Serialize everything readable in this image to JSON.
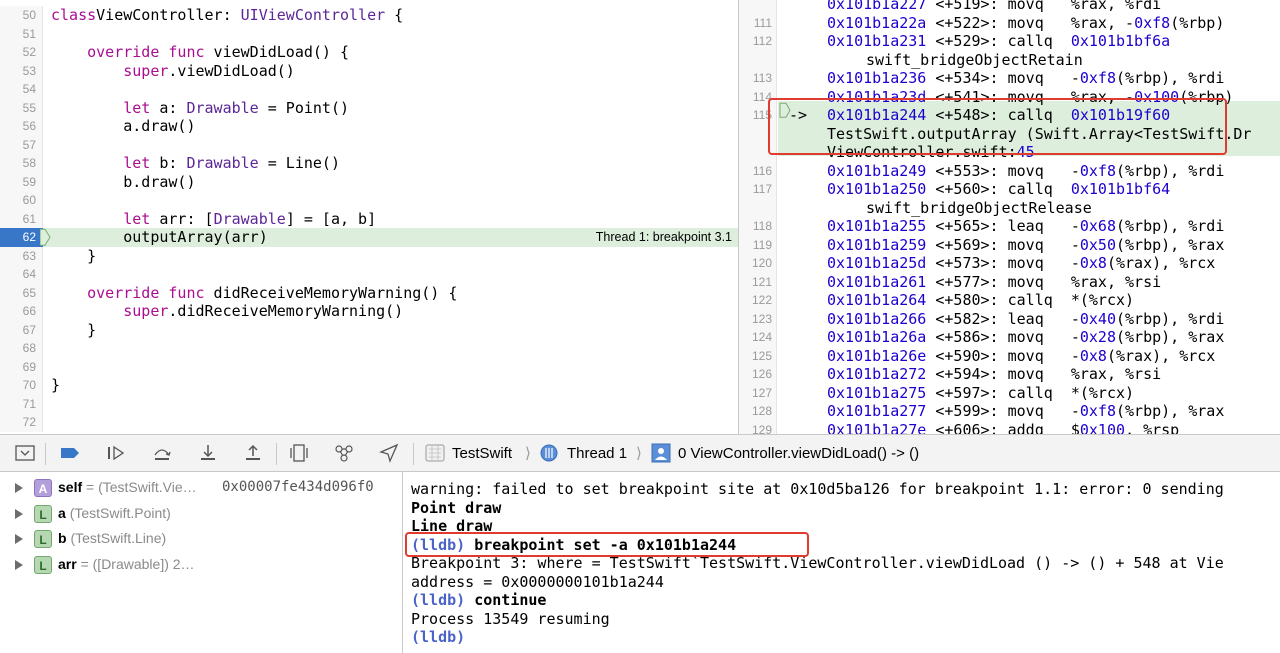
{
  "editor": {
    "lines": [
      {
        "num": "50",
        "parts": [
          [
            "kw",
            "class"
          ],
          [
            "",
            "ViewController: "
          ],
          [
            "ty",
            "UIViewController"
          ],
          [
            "",
            " {"
          ]
        ]
      },
      {
        "num": "51",
        "parts": []
      },
      {
        "num": "52",
        "parts": [
          [
            "",
            "    "
          ],
          [
            "kw",
            "override"
          ],
          [
            "",
            ""
          ],
          [
            "kw",
            " func"
          ],
          [
            "",
            " viewDidLoad() {"
          ]
        ]
      },
      {
        "num": "53",
        "parts": [
          [
            "",
            "        "
          ],
          [
            "kw",
            "super"
          ],
          [
            "",
            ".viewDidLoad()"
          ]
        ]
      },
      {
        "num": "54",
        "parts": []
      },
      {
        "num": "55",
        "parts": [
          [
            "",
            "        "
          ],
          [
            "kw",
            "let"
          ],
          [
            "",
            " a: "
          ],
          [
            "ty",
            "Drawable"
          ],
          [
            "",
            " = Point()"
          ]
        ]
      },
      {
        "num": "56",
        "parts": [
          [
            "",
            "        a.draw()"
          ]
        ]
      },
      {
        "num": "57",
        "parts": []
      },
      {
        "num": "58",
        "parts": [
          [
            "",
            "        "
          ],
          [
            "kw",
            "let"
          ],
          [
            "",
            " b: "
          ],
          [
            "ty",
            "Drawable"
          ],
          [
            "",
            " = Line()"
          ]
        ]
      },
      {
        "num": "59",
        "parts": [
          [
            "",
            "        b.draw()"
          ]
        ]
      },
      {
        "num": "60",
        "parts": []
      },
      {
        "num": "61",
        "parts": [
          [
            "",
            "        "
          ],
          [
            "kw",
            "let"
          ],
          [
            "",
            " arr: ["
          ],
          [
            "ty",
            "Drawable"
          ],
          [
            "",
            "] = [a, b]"
          ]
        ]
      },
      {
        "num": "62",
        "parts": [
          [
            "",
            "        outputArray(arr)"
          ]
        ],
        "highlight": true
      },
      {
        "num": "63",
        "parts": [
          [
            "",
            "    }"
          ]
        ]
      },
      {
        "num": "64",
        "parts": []
      },
      {
        "num": "65",
        "parts": [
          [
            "",
            "    "
          ],
          [
            "kw",
            "override"
          ],
          [
            "kw",
            " func"
          ],
          [
            "",
            " didReceiveMemoryWarning() {"
          ]
        ]
      },
      {
        "num": "66",
        "parts": [
          [
            "",
            "        "
          ],
          [
            "kw",
            "super"
          ],
          [
            "",
            ".didReceiveMemoryWarning()"
          ]
        ]
      },
      {
        "num": "67",
        "parts": [
          [
            "",
            "    }"
          ]
        ]
      },
      {
        "num": "68",
        "parts": []
      },
      {
        "num": "69",
        "parts": []
      },
      {
        "num": "70",
        "parts": [
          [
            "",
            "}"
          ]
        ]
      },
      {
        "num": "71",
        "parts": []
      },
      {
        "num": "72",
        "parts": []
      }
    ],
    "thread_label": "Thread 1: breakpoint 3.1"
  },
  "disasm": {
    "lines": [
      {
        "num": "",
        "parts": [
          [
            "addr",
            "0x101b1a227"
          ],
          [
            "",
            " <+519>: movq   %rax, %rdi"
          ]
        ]
      },
      {
        "num": "111",
        "parts": [
          [
            "addr",
            "0x101b1a22a"
          ],
          [
            "",
            " <+522>: movq   %rax, -"
          ],
          [
            "num",
            "0xf8"
          ],
          [
            "",
            "(%rbp)"
          ]
        ]
      },
      {
        "num": "112",
        "parts": [
          [
            "addr",
            "0x101b1a231"
          ],
          [
            "",
            " <+529>: callq  "
          ],
          [
            "addr",
            "0x101b1bf6a"
          ]
        ]
      },
      {
        "num": "",
        "cont": "swift_bridgeObjectRetain"
      },
      {
        "num": "113",
        "parts": [
          [
            "addr",
            "0x101b1a236"
          ],
          [
            "",
            " <+534>: movq   -"
          ],
          [
            "num",
            "0xf8"
          ],
          [
            "",
            "(%rbp), %rdi"
          ]
        ]
      },
      {
        "num": "114",
        "parts": [
          [
            "addr",
            "0x101b1a23d"
          ],
          [
            "",
            " <+541>: movq   %rax, -"
          ],
          [
            "num",
            "0x100"
          ],
          [
            "",
            "(%rbp)"
          ]
        ]
      },
      {
        "num": "115",
        "parts": [
          [
            "addr",
            "0x101b1a244"
          ],
          [
            "",
            " <+548>: callq  "
          ],
          [
            "addr",
            "0x101b19f60"
          ]
        ],
        "pc": true
      },
      {
        "num": "",
        "parts": [
          [
            "",
            "TestSwift.outputArray (Swift.Array<TestSwift.Dr"
          ]
        ],
        "hl": true
      },
      {
        "num": "",
        "parts": [
          [
            "",
            "ViewController.swift:"
          ],
          [
            "addr",
            "45"
          ]
        ],
        "hl": true
      },
      {
        "num": "116",
        "parts": [
          [
            "addr",
            "0x101b1a249"
          ],
          [
            "",
            " <+553>: movq   -"
          ],
          [
            "num",
            "0xf8"
          ],
          [
            "",
            "(%rbp), %rdi"
          ]
        ]
      },
      {
        "num": "117",
        "parts": [
          [
            "addr",
            "0x101b1a250"
          ],
          [
            "",
            " <+560>: callq  "
          ],
          [
            "addr",
            "0x101b1bf64"
          ]
        ]
      },
      {
        "num": "",
        "cont": "swift_bridgeObjectRelease"
      },
      {
        "num": "118",
        "parts": [
          [
            "addr",
            "0x101b1a255"
          ],
          [
            "",
            " <+565>: leaq   -"
          ],
          [
            "num",
            "0x68"
          ],
          [
            "",
            "(%rbp), %rdi"
          ]
        ]
      },
      {
        "num": "119",
        "parts": [
          [
            "addr",
            "0x101b1a259"
          ],
          [
            "",
            " <+569>: movq   -"
          ],
          [
            "num",
            "0x50"
          ],
          [
            "",
            "(%rbp), %rax"
          ]
        ]
      },
      {
        "num": "120",
        "parts": [
          [
            "addr",
            "0x101b1a25d"
          ],
          [
            "",
            " <+573>: movq   -"
          ],
          [
            "num",
            "0x8"
          ],
          [
            "",
            "(%rax), %rcx"
          ]
        ]
      },
      {
        "num": "121",
        "parts": [
          [
            "addr",
            "0x101b1a261"
          ],
          [
            "",
            " <+577>: movq   %rax, %rsi"
          ]
        ]
      },
      {
        "num": "122",
        "parts": [
          [
            "addr",
            "0x101b1a264"
          ],
          [
            "",
            " <+580>: callq  *(%rcx)"
          ]
        ]
      },
      {
        "num": "123",
        "parts": [
          [
            "addr",
            "0x101b1a266"
          ],
          [
            "",
            " <+582>: leaq   -"
          ],
          [
            "num",
            "0x40"
          ],
          [
            "",
            "(%rbp), %rdi"
          ]
        ]
      },
      {
        "num": "124",
        "parts": [
          [
            "addr",
            "0x101b1a26a"
          ],
          [
            "",
            " <+586>: movq   -"
          ],
          [
            "num",
            "0x28"
          ],
          [
            "",
            "(%rbp), %rax"
          ]
        ]
      },
      {
        "num": "125",
        "parts": [
          [
            "addr",
            "0x101b1a26e"
          ],
          [
            "",
            " <+590>: movq   -"
          ],
          [
            "num",
            "0x8"
          ],
          [
            "",
            "(%rax), %rcx"
          ]
        ]
      },
      {
        "num": "126",
        "parts": [
          [
            "addr",
            "0x101b1a272"
          ],
          [
            "",
            " <+594>: movq   %rax, %rsi"
          ]
        ]
      },
      {
        "num": "127",
        "parts": [
          [
            "addr",
            "0x101b1a275"
          ],
          [
            "",
            " <+597>: callq  *(%rcx)"
          ]
        ]
      },
      {
        "num": "128",
        "parts": [
          [
            "addr",
            "0x101b1a277"
          ],
          [
            "",
            " <+599>: movq   -"
          ],
          [
            "num",
            "0xf8"
          ],
          [
            "",
            "(%rbp), %rax"
          ]
        ]
      },
      {
        "num": "129",
        "parts": [
          [
            "addr",
            "0x101b1a27e"
          ],
          [
            "",
            " <+606>: addq   $"
          ],
          [
            "num",
            "0x100"
          ],
          [
            "",
            ", %rsp"
          ]
        ]
      }
    ],
    "pc_arrow": "->"
  },
  "debugbar": {
    "buttons": [
      "hide-debug-area-icon",
      "breakpoints-toggle-icon",
      "continue-icon",
      "step-over-icon",
      "step-into-icon",
      "step-out-icon",
      "view-debugger-icon",
      "memory-graph-icon",
      "location-icon"
    ],
    "crumbs": {
      "target": "TestSwift",
      "thread": "Thread 1",
      "frame": "0 ViewController.viewDidLoad() -> ()"
    }
  },
  "variables": [
    {
      "badge": "A",
      "kind": "a",
      "name": "self",
      "type": "= (TestSwift.Vie…",
      "value": "0x00007fe434d096f0"
    },
    {
      "badge": "L",
      "kind": "l",
      "name": "a",
      "type": "(TestSwift.Point)",
      "value": ""
    },
    {
      "badge": "L",
      "kind": "l",
      "name": "b",
      "type": "(TestSwift.Line)",
      "value": ""
    },
    {
      "badge": "L",
      "kind": "l",
      "name": "arr",
      "type": "= ([Drawable]) 2…",
      "value": ""
    }
  ],
  "console": {
    "lines": [
      {
        "text": "warning: failed to set breakpoint site at 0x10d5ba126 for breakpoint 1.1: error: 0 sending",
        "bold": false
      },
      {
        "text": "Point draw",
        "bold": true
      },
      {
        "text": "Line draw",
        "bold": true
      },
      {
        "prompt": "(lldb)",
        "text": " breakpoint set -a 0x101b1a244",
        "bold": true
      },
      {
        "text": "Breakpoint 3: where = TestSwift`TestSwift.ViewController.viewDidLoad () -> () + 548 at Vie",
        "bold": false
      },
      {
        "text": "address = 0x0000000101b1a244",
        "bold": false
      },
      {
        "prompt": "(lldb)",
        "text": " continue",
        "bold": true
      },
      {
        "text": "Process 13549 resuming",
        "bold": false
      },
      {
        "prompt": "(lldb)",
        "text": "",
        "bold": true
      }
    ]
  },
  "colors": {
    "keyword": "#aa0d91",
    "type": "#5c2699",
    "number": "#1c00cf",
    "current_line": "#ddeedd",
    "breakpoint": "#3876c8",
    "annotation": "#e03b2e"
  }
}
